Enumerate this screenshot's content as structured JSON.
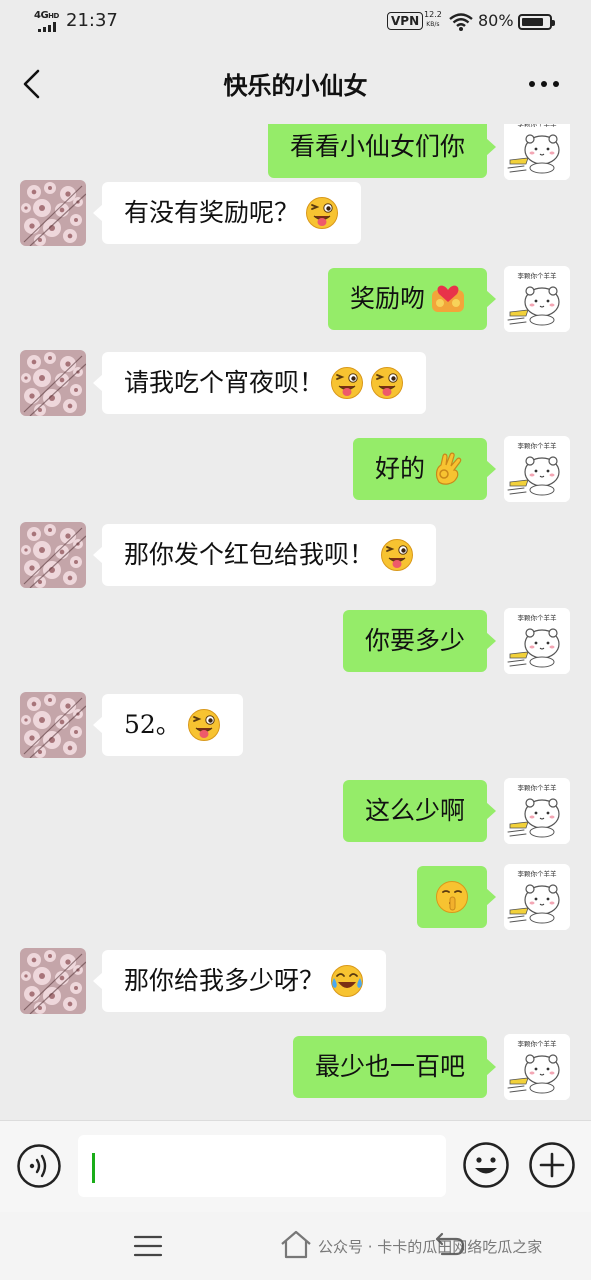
{
  "status_bar": {
    "network": "4G",
    "network_sup": "HD",
    "time": "21:37",
    "vpn": "VPN",
    "speed_value": "12.2",
    "speed_unit": "KB/s",
    "battery_percent": 80,
    "battery_text": "80%"
  },
  "header": {
    "title": "快乐的小仙女"
  },
  "colors": {
    "background": "#ececec",
    "sent_bubble": "#95ec69",
    "received_bubble": "#ffffff",
    "caret": "#1aad19"
  },
  "messages": [
    {
      "side": "right",
      "text": "看看小仙女们你",
      "emoji": "",
      "partially_hidden": true
    },
    {
      "side": "left",
      "text": "有没有奖励呢？",
      "emoji": "wink-tongue-face"
    },
    {
      "side": "right",
      "text": "奖励吻",
      "emoji": "kissing-couple"
    },
    {
      "side": "left",
      "text": "请我吃个宵夜呗！",
      "emoji": "wink-tongue-face-x2"
    },
    {
      "side": "right",
      "text": "好的",
      "emoji": "ok-hand"
    },
    {
      "side": "left",
      "text": "那你发个红包给我呗！",
      "emoji": "wink-tongue-face"
    },
    {
      "side": "right",
      "text": "你要多少",
      "emoji": ""
    },
    {
      "side": "left",
      "text": "52。",
      "emoji": "wink-tongue-face"
    },
    {
      "side": "right",
      "text": "这么少啊",
      "emoji": ""
    },
    {
      "side": "right",
      "text": "",
      "emoji": "shushing-face"
    },
    {
      "side": "left",
      "text": "那你给我多少呀？",
      "emoji": "crying-laughing-face"
    },
    {
      "side": "right",
      "text": "最少也一百吧",
      "emoji": ""
    }
  ],
  "sticker_avatar_caption": "李颗你个羊羊",
  "input": {
    "value": ""
  },
  "watermark": "公众号 · 卡卡的瓜田网络吃瓜之家"
}
